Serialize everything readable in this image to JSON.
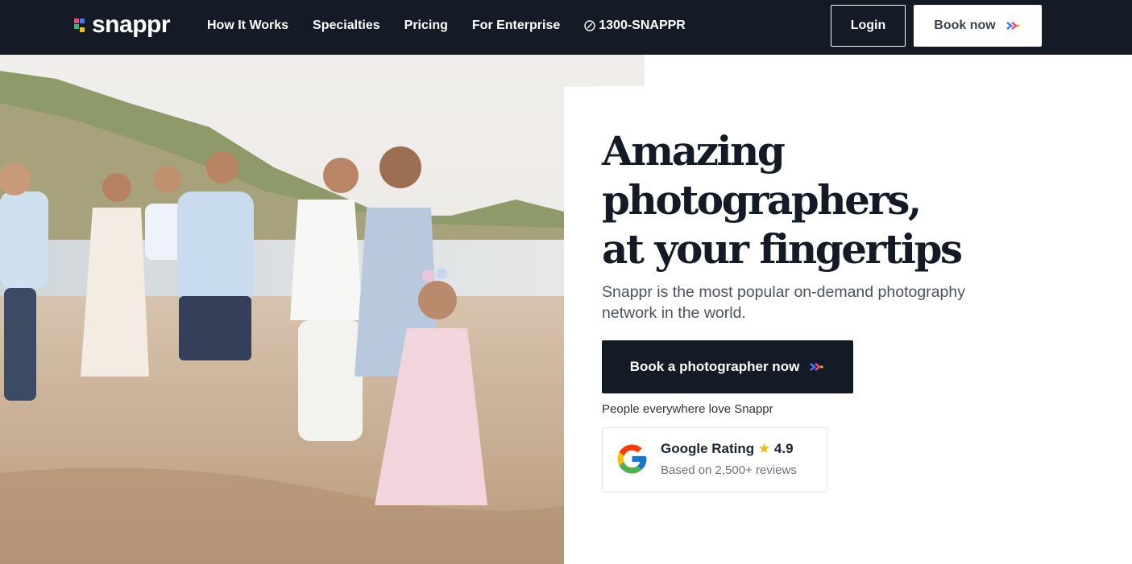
{
  "nav": {
    "logo_text": "snappr",
    "links": [
      "How It Works",
      "Specialties",
      "Pricing",
      "For Enterprise"
    ],
    "phone": "1300-SNAPPR",
    "phone_icon": "phone-icon",
    "login_label": "Login",
    "book_label": "Book now"
  },
  "hero": {
    "image": "family-walking-on-beach-photo",
    "headline": "Amazing photographers, at your fingertips",
    "subtitle": "Snappr is the most popular on-demand photography network in the world.",
    "cta_label": "Book a photographer now",
    "social_proof": "People everywhere love Snappr",
    "rating": {
      "title": "Google Rating",
      "star": "★",
      "score": "4.9",
      "reviews": "Based on 2,500+ reviews",
      "icon": "google-icon"
    }
  },
  "colors": {
    "nav_bg": "#141b26",
    "accent_blue": "#3a7bfd",
    "accent_pink": "#ef4a7b",
    "accent_yellow": "#f8c300",
    "accent_green": "#2fbf71",
    "star": "#f2b705"
  }
}
